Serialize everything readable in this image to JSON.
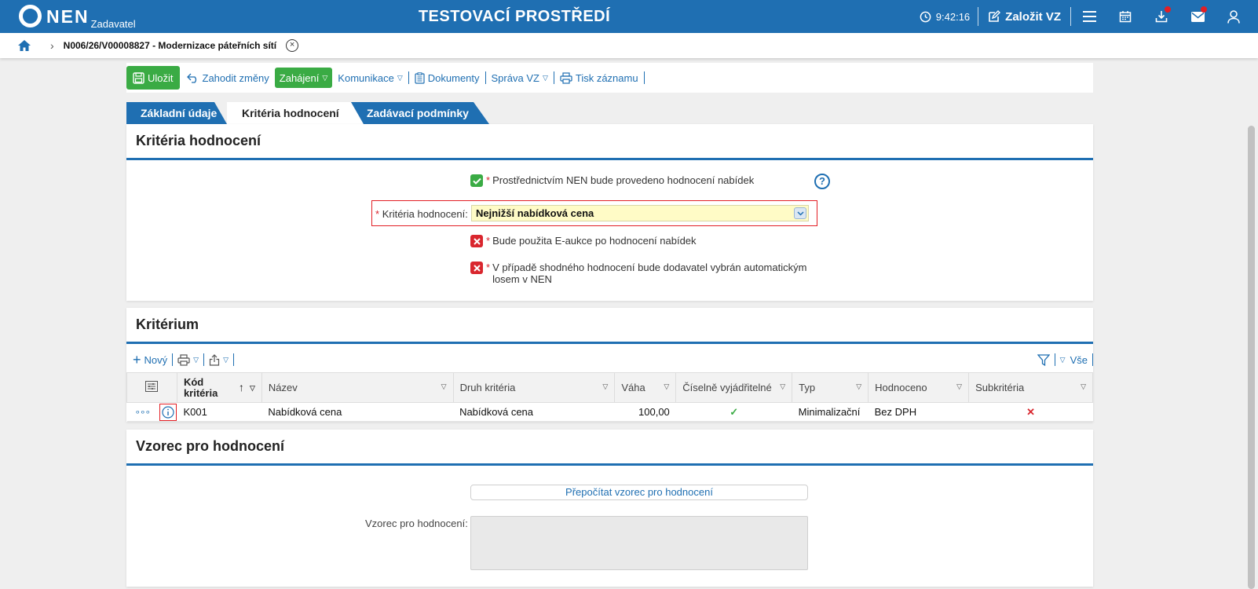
{
  "header": {
    "logo_text": "NEN",
    "logo_sub": "Zadavatel",
    "env_title": "TESTOVACÍ PROSTŘEDÍ",
    "time": "9:42:16",
    "create_label": "Založit VZ"
  },
  "breadcrumb": {
    "text": "N006/26/V00008827 - Modernizace páteřních sítí"
  },
  "toolbar": {
    "save": "Uložit",
    "discard": "Zahodit změny",
    "start": "Zahájení",
    "communication": "Komunikace",
    "documents": "Dokumenty",
    "manage": "Správa VZ",
    "print": "Tisk záznamu"
  },
  "tabs": [
    "Základní údaje",
    "Kritéria hodnocení",
    "Zadávací podmínky"
  ],
  "criteria_panel": {
    "title": "Kritéria hodnocení",
    "eval_by_nen": "Prostřednictvím NEN bude provedeno hodnocení nabídek",
    "criteria_label": "Kritéria hodnocení:",
    "criteria_value": "Nejnižší nabídková cena",
    "eauction": "Bude použita E-aukce po hodnocení nabídek",
    "lot_line1": "V případě shodného hodnocení bude dodavatel vybrán automatickým",
    "lot_line2": "losem v NEN",
    "help": "?"
  },
  "criterion_panel": {
    "title": "Kritérium",
    "new": "Nový",
    "all": "Vše",
    "columns": [
      "Kód kritéria",
      "Název",
      "Druh kritéria",
      "Váha",
      "Číselně vyjádřitelné",
      "Typ",
      "Hodnoceno",
      "Subkritéria"
    ],
    "rows": [
      {
        "code": "K001",
        "name": "Nabídková cena",
        "kind": "Nabídková cena",
        "weight": "100,00",
        "numeric": "✓",
        "type": "Minimalizační",
        "evaluated": "Bez DPH",
        "sub": "✕"
      }
    ]
  },
  "formula_panel": {
    "title": "Vzorec pro hodnocení",
    "recalc": "Přepočítat vzorec pro hodnocení",
    "label": "Vzorec pro hodnocení:"
  },
  "colors": {
    "brand_blue": "#1f6fb2",
    "green": "#3aab44",
    "red": "#d9262e",
    "highlight": "#fffbc6"
  }
}
